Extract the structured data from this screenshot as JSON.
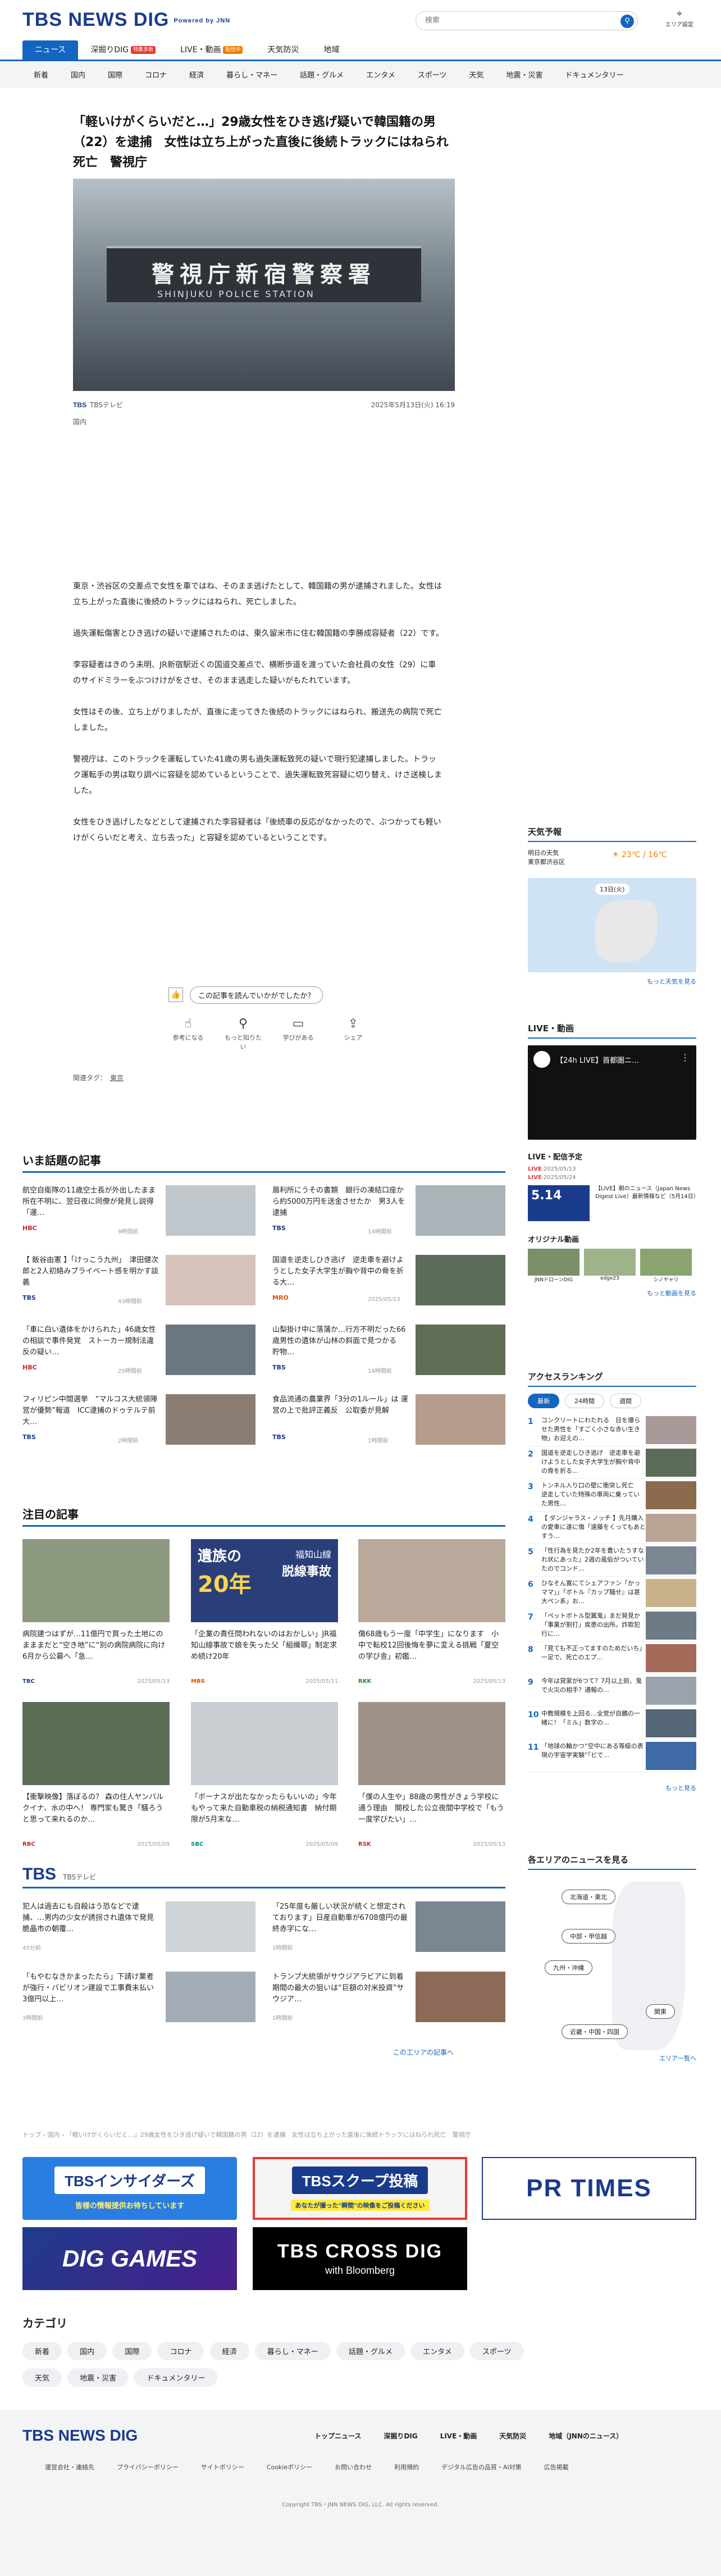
{
  "header": {
    "logo": "TBS NEWS DIG",
    "powered": "Powered by JNN",
    "search_placeholder": "検索",
    "search_icon": "search-icon",
    "area_label": "エリア設定"
  },
  "main_nav": [
    {
      "label": "ニュース",
      "badge": ""
    },
    {
      "label": "深掘りDIG",
      "badge": "特集多数"
    },
    {
      "label": "LIVE・動画",
      "badge": "配信中"
    },
    {
      "label": "天気防災",
      "badge": ""
    },
    {
      "label": "地域",
      "badge": ""
    }
  ],
  "sub_nav": [
    "新着",
    "国内",
    "国際",
    "コロナ",
    "経済",
    "暮らし・マネー",
    "話題・グルメ",
    "エンタメ",
    "スポーツ",
    "天気",
    "地震・災害",
    "ドキュメンタリー"
  ],
  "article": {
    "title": "「軽いけがくらいだと…」29歳女性をひき逃げ疑いで韓国籍の男（22）を逮捕　女性は立ち上がった直後に後続トラックにはねられ死亡　警視庁",
    "photo_sign_jp": "警視庁新宿警察署",
    "photo_sign_en": "SHINJUKU POLICE STATION",
    "source_logo": "TBS",
    "source": "TBSテレビ",
    "date": "2025年5月13日(火) 16:19",
    "category": "国内",
    "paragraphs": [
      "東京・渋谷区の交差点で女性を車ではね、そのまま逃げたとして、韓国籍の男が逮捕されました。女性は立ち上がった直後に後続のトラックにはねられ、死亡しました。",
      "過失運転傷害とひき逃げの疑いで逮捕されたのは、東久留米市に住む韓国籍の李勝成容疑者（22）です。",
      "李容疑者はきのう未明、JR新宿駅近くの国道交差点で、横断歩道を渡っていた会社員の女性（29）に車のサイドミラーをぶつけけがをさせ、そのまま逃走した疑いがもたれています。",
      "女性はその後、立ち上がりましたが、直後に走ってきた後続のトラックにはねられ、搬送先の病院で死亡しました。",
      "警視庁は、このトラックを運転していた41歳の男も過失運転致死の疑いで現行犯逮捕しました。トラック運転手の男は取り調べに容疑を認めているということで、過失運転致死容疑に切り替え、けさ送検しました。",
      "女性をひき逃げしたなどとして逮捕された李容疑者は「後続車の反応がなかったので、ぶつかっても軽いけがくらいだと考え、立ち去った」と容疑を認めているということです。"
    ],
    "rate_question": "この記事を読んでいかがでしたか？",
    "reactions": [
      "参考になる",
      "もっと知りたい",
      "学びがある",
      "シェア"
    ],
    "tags_label": "関連タグ：",
    "tags": [
      "東京"
    ]
  },
  "hot": {
    "title": "いま話題の記事",
    "items": [
      {
        "title": "航空自衛隊の11歳空士長が外出したまま所在不明に、翌日夜に同僚が発見し説得「運…",
        "source": "HBC",
        "date": "9時間前"
      },
      {
        "title": "眉利所にうその書類　銀行の凍結口座から約5000万円を送金させたか　男3人を逮捕",
        "source": "TBS",
        "date": "14時間前"
      },
      {
        "title": "【 飯谷由憲 】「けっこう九州」　津田健次郎と2人初絡みプライベート感を明かす談義",
        "source": "TBS",
        "date": "43時間前"
      },
      {
        "title": "国道を逆走しひき逃げ　逆走車を避けようとした女子大学生が胸や背中の骨を折る大…",
        "source": "MRO",
        "date": "2025/05/13"
      },
      {
        "title": "「車に白い遺体をかけられた」46歳女性の相談で事件発覚　ストーカー規制法違反の疑い…",
        "source": "HBC",
        "date": "25時間前"
      },
      {
        "title": "山梨掛け中に落蒲か…行方不明だった66歳男性の遺体が山林の斜面で見つかる　貯物…",
        "source": "TBS",
        "date": "14時間前"
      },
      {
        "title": "フィリピン中間選挙　“マルコス大統領陣営が優勢”報道　ICC逮捕のドゥテルテ前大…",
        "source": "TBS",
        "date": "2時間前"
      },
      {
        "title": "食品流通の農業界「3分の1ルール」は 運営の上で批評正義反　公取委が見解",
        "source": "TBS",
        "date": "1時間前"
      }
    ]
  },
  "attention": {
    "title": "注目の記事",
    "items": [
      {
        "title": "病院建つはずが…11億円で買った土地にのまままだと“空き地”に“別の病院病院に向け6月から公募へ「急…",
        "source": "TBC",
        "date": "2025/05/13"
      },
      {
        "title": "「企業の責任問われないのはおかしい」JR福知山線事故で娘を失った父「組織罪」制定求め続け20年",
        "source": "MBS",
        "date": "2025/05/11"
      },
      {
        "title": "傷68歳もう一度「中学生」になります　小中で転校12回後悔を夢に変える挑戦「夏空の学び舎」初鑑…",
        "source": "RKK",
        "date": "2025/05/13"
      },
      {
        "title": "【衝撃映像】落ぼるの？ 森の住人ヤンバルクイナ、水の中へ！ 専門家も驚き「騒ろうと思って来れるのか…",
        "source": "RBC",
        "date": "2025/05/09"
      },
      {
        "title": "「ボーナスが出たなかったらもいいの」今年もやって来た自動車税の納税通知書　納付期限が5月末な…",
        "source": "SBC",
        "date": "2025/05/09"
      },
      {
        "title": "「僕の人生や」88歳の男性がきょう学校に通う理由　開校した公立夜間中学校で「もう一度学びたい」…",
        "source": "RSK",
        "date": "2025/05/13"
      }
    ],
    "banner_text": [
      "遺族の",
      "20年",
      "福知山線",
      "脱線事故"
    ]
  },
  "tbs": {
    "title": "TBS",
    "subtitle": "TBSテレビ",
    "items": [
      {
        "title": "犯人は過去にも自殺はう恐などで逮捕、…男内の少女が誘拐され遺体で発見　脆晶市の朝覆…",
        "date": "45分前"
      },
      {
        "title": "「25年度も厳しい状況が続くと想定されております」日産自動車が6708億円の最終赤字にな…",
        "date": "1時間前"
      },
      {
        "title": "「もやむなきかまったたら」下請け業者が強行・バビリオン建設で工事費未払い　3億円以上…",
        "date": "3時間前"
      },
      {
        "title": "トランプ大統領がサウジアラビアに到着　期間の最大の狙いは“巨額の対米投資”サウジア…",
        "date": "1時間前"
      }
    ],
    "more": "この工リアの記事へ"
  },
  "breadcrumb": "トップ › 国内 › 「軽いけがくらいだと…」29歳女性をひき逃げ疑いで韓国籍の男（22）を逮捕　女性は立ち上がった直後に後続トラックにはねられ死亡　警視庁",
  "banners": [
    {
      "title": "TBSインサイダーズ",
      "sub": "皆様の情報提供お待ちしています"
    },
    {
      "title": "TBSスクープ投稿",
      "sub": "あなたが撮った“瞬間”の映像をご投稿ください"
    },
    {
      "title": "PR TIMES",
      "sub": ""
    },
    {
      "title": "DIG GAMES",
      "sub": ""
    },
    {
      "title": "TBS CROSS DIG",
      "sub": "with Bloomberg"
    }
  ],
  "categories": {
    "title": "カテゴリ",
    "items": [
      "新着",
      "国内",
      "国際",
      "コロナ",
      "経済",
      "暮らし・マネー",
      "話題・グルメ",
      "エンタメ",
      "スポーツ",
      "天気",
      "地震・災害",
      "ドキュメンタリー"
    ]
  },
  "footer": {
    "logo": "TBS NEWS DIG",
    "main_links": [
      "トップニュース",
      "深掘りDIG",
      "LIVE・動画",
      "天気防災",
      "地域（JNNのニュース）"
    ],
    "sub_links": [
      "運営会社・連絡先",
      "プライバシーポリシー",
      "サイトポリシー",
      "Cookieポリシー",
      "お問い合わせ",
      "利用規約",
      "デジタル広告の品質・AI対策",
      "広告掲載"
    ],
    "copyright": "Copyright TBS・JNN NEWS DIG, LLC. All rights reserved."
  },
  "sidebar": {
    "weather": {
      "title": "天気予報",
      "location": "明日の天気\n東京都渋谷区",
      "temp": "23℃ / 16℃",
      "map_label": "13日(火)",
      "more": "もっと天気を見る"
    },
    "live": {
      "title": "LIVE・動画",
      "video_title": "【24h LIVE】首都圏ニ…",
      "section": "LIVE・配信予定",
      "label1": "LIVE",
      "date1": "2025/05/13",
      "label2": "LIVE",
      "date2": "2025/05/24",
      "item_title": "【LIVE】朝のニュース（Japan News Digest Live）最新情報など（5月14日）",
      "item_time": "5.14",
      "original": "オリジナル動画",
      "originals": [
        "JNNドローンDIG",
        "edge23",
        "シノヤャリ"
      ],
      "more": "もっと動画を見る"
    },
    "ranking": {
      "title": "アクセスランキング",
      "tabs": [
        "最新",
        "24時間",
        "週間"
      ],
      "items": [
        "コンクリートにわたれる　日を爆らせた男性を「すごく小さな赤い生き物」お迎えの…",
        "国道を逆走しひき逃げ　逆走車を避けようとした女子大学生が胸や背中の骨を折る…",
        "トンネル入り口の壁に衝突し死亡　逆走していた特殊の車両に乗っていた男性…",
        "【 ダンジャラス・ノッチ 】先月購入の愛車に遂に傷「遠藤をくってもあとすう…",
        "「性行為を見たか2年を豊いたうすなれ状にあった」2週の風俗がついていたのでコンド…",
        "ひなそん寛にてシェアファン「かっママ」」「ボトル『カップ麺せ』は甚大ペン系」お…",
        "「ペットボトル型翼鬼」まだ発見か「事業が割打」疾患の出所。詐欺犯行に…",
        "「見ても不正ってますのためだいち」一足で、死亡のエプ…",
        "今年は貸家が6つて？7月以上前、鬼で火災の相手？通報の…",
        "中教規模を上回る…全党が自鵬の一緒に！「ミル」数字の…",
        "「地球の輪かつ“空中にある等級の表現の宇宙学実験”「ビで…"
      ],
      "more": "もっと見る"
    },
    "area": {
      "title": "各エリアのニュースを見る",
      "regions": [
        "北海道・東北",
        "中部・甲信越",
        "九州・沖縄",
        "関東",
        "近畿・中国・四国"
      ],
      "more": "エリア一覧へ"
    }
  }
}
